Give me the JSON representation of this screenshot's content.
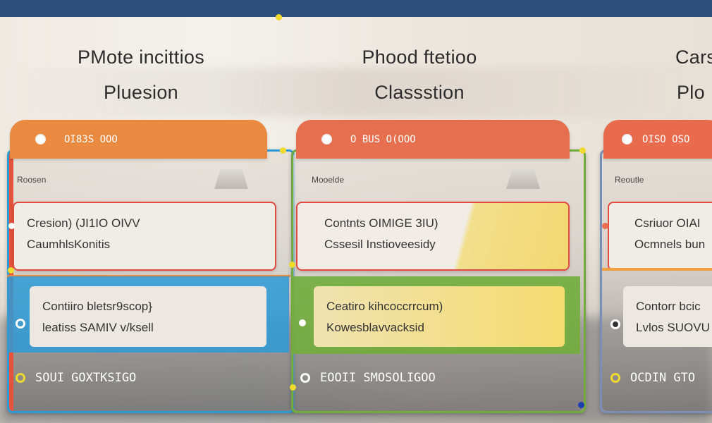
{
  "colors": {
    "top_bar": "#2d4f7c",
    "accent_yellow": "#f1da2e",
    "col1_tab": "#e98a40",
    "col1_frame": "#2e9ad6",
    "col2_tab": "#e56f4f",
    "col2_frame": "#72ad3c",
    "col3_tab": "#e86b4e",
    "col3_frame": "#7a8fb8"
  },
  "columns": [
    {
      "title_line1": "PMote incittios",
      "title_line2": "Pluesion",
      "tab_label": "OI83S OOO",
      "section_label": "Roosen",
      "card1_line1": "Cresion) (JI1IO OIVV",
      "card1_line2": "CaumhlsKonitis",
      "card2_line1": "Contiiro bletsr9scop}",
      "card2_line2": "leatiss SAMIV v/ksell",
      "footer_label": "SOUI GOXTKSIGO"
    },
    {
      "title_line1": "Phood ftetioo",
      "title_line2": "Classstion",
      "tab_label": "O BUS O(OOO",
      "section_label": "Mooelde",
      "card1_line1": "Contnts OIMIGE 3IU)",
      "card1_line2": "Cssesil Instioveesidy",
      "card2_line1": "Ceatiro kihcoccrrcum)",
      "card2_line2": "Kowesblavvacksid",
      "footer_label": "EOOII SMOSOLIGOO"
    },
    {
      "title_line1": "Cars",
      "title_line2": "Plo",
      "tab_label": "OISO  OSO",
      "section_label": "Reoutle",
      "card1_line1": "Csriuor OIAI",
      "card1_line2": "Ocmnels bun",
      "card2_line1": "Contorr bcic",
      "card2_line2": "Lvlos SUOVU",
      "footer_label": "OCDIN GTO"
    }
  ]
}
